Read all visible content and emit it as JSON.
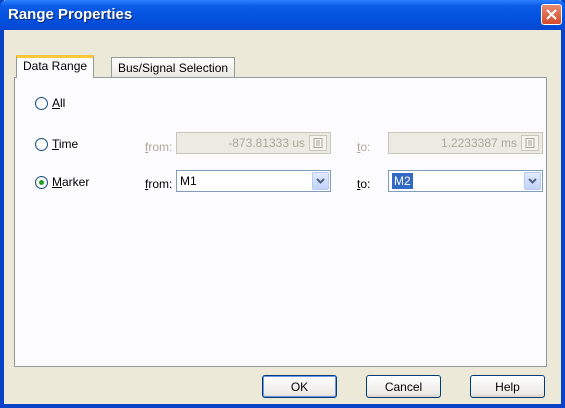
{
  "window": {
    "title": "Range Properties"
  },
  "tabs": [
    {
      "label": "Data Range",
      "active": true
    },
    {
      "label": "Bus/Signal Selection",
      "active": false
    }
  ],
  "range_options": {
    "all": {
      "label_access": "A",
      "label_rest": "ll",
      "selected": false
    },
    "time": {
      "label_access": "T",
      "label_rest": "ime",
      "selected": false,
      "from_label_access": "f",
      "from_label_rest": "rom:",
      "from_value": "-873.81333 us",
      "to_label_access": "t",
      "to_label_rest": "o:",
      "to_value": "1.2233387 ms"
    },
    "marker": {
      "label_access": "M",
      "label_rest": "arker",
      "selected": true,
      "from_label_access": "f",
      "from_label_rest": "rom:",
      "from_value": "M1",
      "to_label_access": "t",
      "to_label_rest": "o:",
      "to_value": "M2"
    }
  },
  "buttons": {
    "ok": "OK",
    "cancel": "Cancel",
    "help": "Help"
  },
  "colors": {
    "title_bar": "#0453e0",
    "selection": "#316ac5",
    "radio_dot": "#21a121",
    "tab_highlight": "#ffc83c"
  }
}
